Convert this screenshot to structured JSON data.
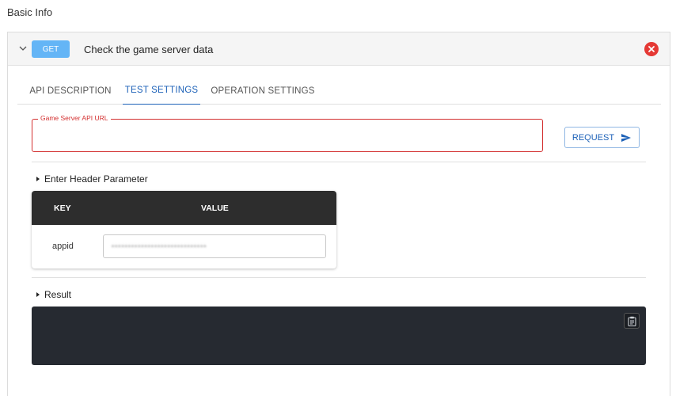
{
  "page": {
    "title": "Basic Info"
  },
  "api": {
    "method": "GET",
    "title": "Check the game server data"
  },
  "tabs": [
    {
      "label": "API DESCRIPTION"
    },
    {
      "label": "TEST SETTINGS",
      "active": true
    },
    {
      "label": "OPERATION SETTINGS"
    }
  ],
  "url_field": {
    "label": "Game Server API URL",
    "value": ""
  },
  "request_button": {
    "label": "REQUEST"
  },
  "header_section": {
    "label": "Enter Header Parameter",
    "columns": [
      "KEY",
      "VALUE"
    ],
    "rows": [
      {
        "key": "appid",
        "value": "•••••••••••••••••••••••••••••"
      }
    ]
  },
  "result_section": {
    "label": "Result",
    "content": ""
  },
  "colors": {
    "accent": "#1e62b8",
    "method_badge": "#64b5f6",
    "error": "#d32f2f",
    "table_header": "#2d2d2d",
    "result_bg": "#262a31"
  },
  "icons": {
    "collapse": "chevron-down-icon",
    "close": "close-circle-icon",
    "send": "send-icon",
    "copy": "clipboard-icon"
  }
}
